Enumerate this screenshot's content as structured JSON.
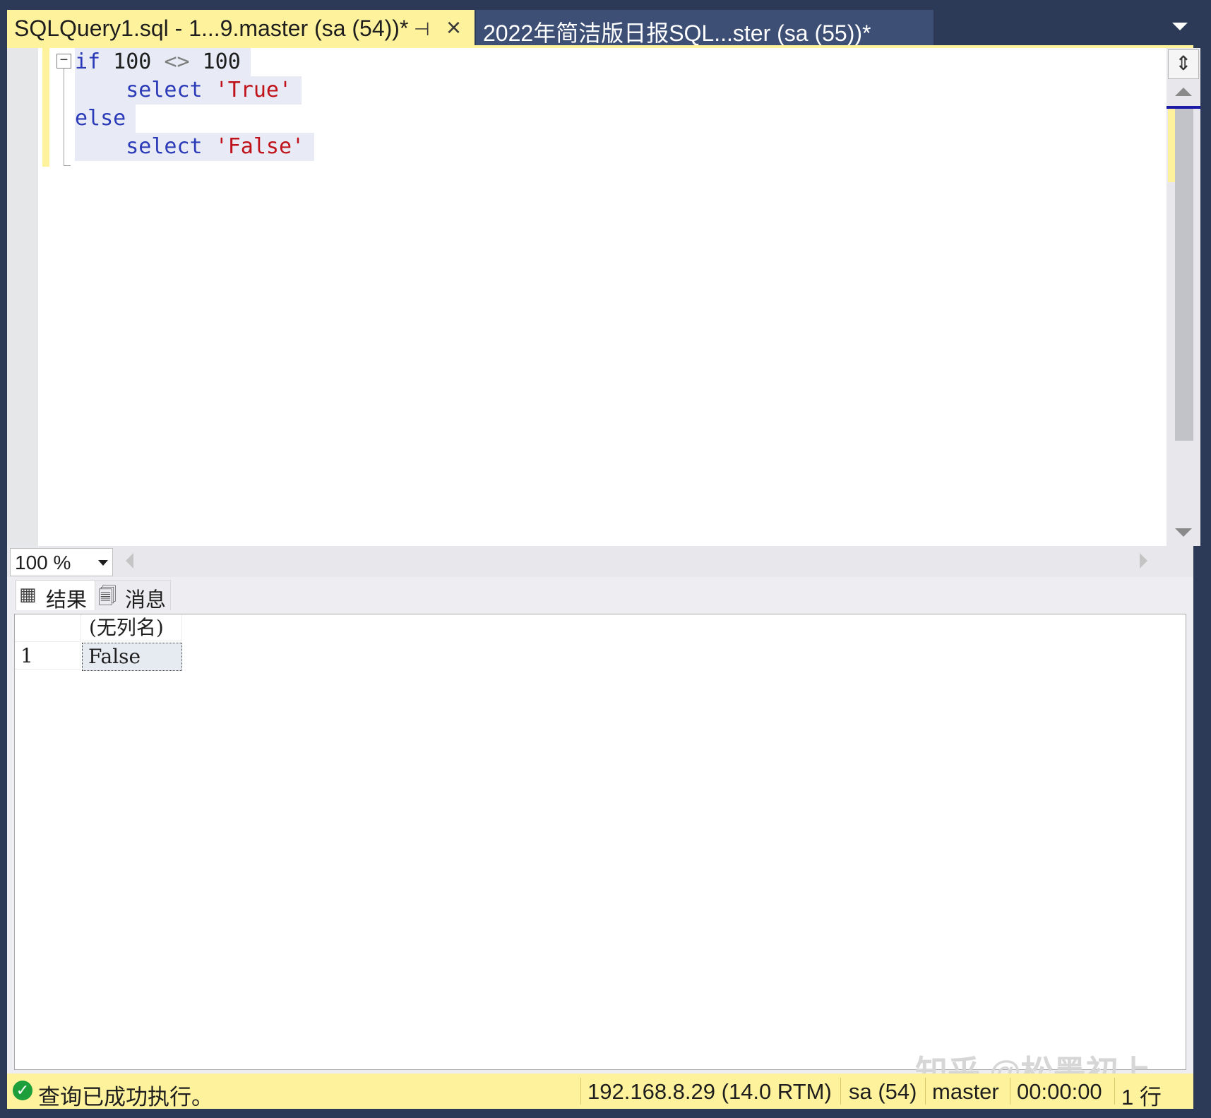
{
  "tabs": [
    {
      "label": "SQLQuery1.sql - 1...9.master (sa (54))*",
      "active": true
    },
    {
      "label": "2022年简洁版日报SQL...ster (sa (55))*",
      "active": false
    }
  ],
  "tab_icons": {
    "pin": "pin-icon",
    "close": "close-icon",
    "overflow": "chevron-down-icon"
  },
  "editor": {
    "lines": [
      {
        "tokens": [
          {
            "t": "if",
            "c": "kw"
          },
          {
            "t": " 100 ",
            "c": "plain"
          },
          {
            "t": "<>",
            "c": "op"
          },
          {
            "t": " 100",
            "c": "plain"
          }
        ]
      },
      {
        "tokens": [
          {
            "t": "    select ",
            "c": "kw"
          },
          {
            "t": "'True'",
            "c": "str"
          }
        ]
      },
      {
        "tokens": [
          {
            "t": "else",
            "c": "kw"
          }
        ]
      },
      {
        "tokens": [
          {
            "t": "    select ",
            "c": "kw"
          },
          {
            "t": "'False'",
            "c": "str"
          }
        ]
      }
    ],
    "fold_symbol": "−"
  },
  "zoom": {
    "value": "100 %"
  },
  "results": {
    "tabs": [
      {
        "label": "结果",
        "icon": "grid-icon"
      },
      {
        "label": "消息",
        "icon": "messages-icon"
      }
    ],
    "columns": [
      "(无列名)"
    ],
    "rows": [
      {
        "num": "1",
        "cells": [
          "False"
        ]
      }
    ]
  },
  "watermark": "知乎 @松墨初上",
  "status": {
    "message": "查询已成功执行。",
    "server": "192.168.8.29 (14.0 RTM)",
    "user": "sa (54)",
    "database": "master",
    "elapsed": "00:00:00",
    "rows": "1 行"
  },
  "colors": {
    "frame": "#2d3a57",
    "active_tab": "#fff29d",
    "inactive_tab": "#3d4f74",
    "keyword": "#2b3ab8",
    "string": "#c0121a",
    "status_bar": "#fff29d",
    "success": "#1e9e3a"
  }
}
